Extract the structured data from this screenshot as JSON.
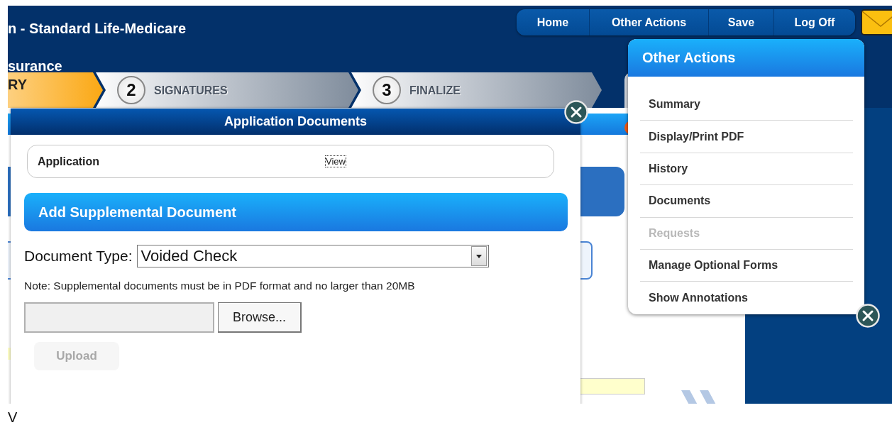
{
  "header": {
    "title": "n - Standard Life-Medicare",
    "subtitle": "surance"
  },
  "nav": [
    {
      "label": "Home"
    },
    {
      "label": "Other Actions"
    },
    {
      "label": "Save"
    },
    {
      "label": "Log Off"
    }
  ],
  "steps": [
    {
      "label": "RY",
      "selected": true
    },
    {
      "number": "2",
      "label": "SIGNATURES",
      "selected": false
    },
    {
      "number": "3",
      "label": "FINALIZE",
      "selected": false
    }
  ],
  "documents_dialog": {
    "title": "Application Documents",
    "documents": [
      {
        "name": "Application",
        "link": "View"
      }
    ],
    "section_title": "Add Supplemental Document",
    "document_type": {
      "label": "Document Type:",
      "value": "Voided Check"
    },
    "note": "Note: Supplemental documents must be in PDF format and no larger than 20MB",
    "browse_button": "Browse...",
    "upload_button": {
      "label": "Upload",
      "disabled": true
    }
  },
  "other_actions_menu": {
    "title": "Other Actions",
    "items": [
      {
        "label": "Summary",
        "disabled": false
      },
      {
        "label": "Display/Print PDF",
        "disabled": false
      },
      {
        "label": "History",
        "disabled": false
      },
      {
        "label": "Documents",
        "disabled": false
      },
      {
        "label": "Requests",
        "disabled": true
      },
      {
        "label": "Manage Optional Forms",
        "disabled": false
      },
      {
        "label": "Show Annotations",
        "disabled": false
      }
    ]
  },
  "footer_text": "V"
}
